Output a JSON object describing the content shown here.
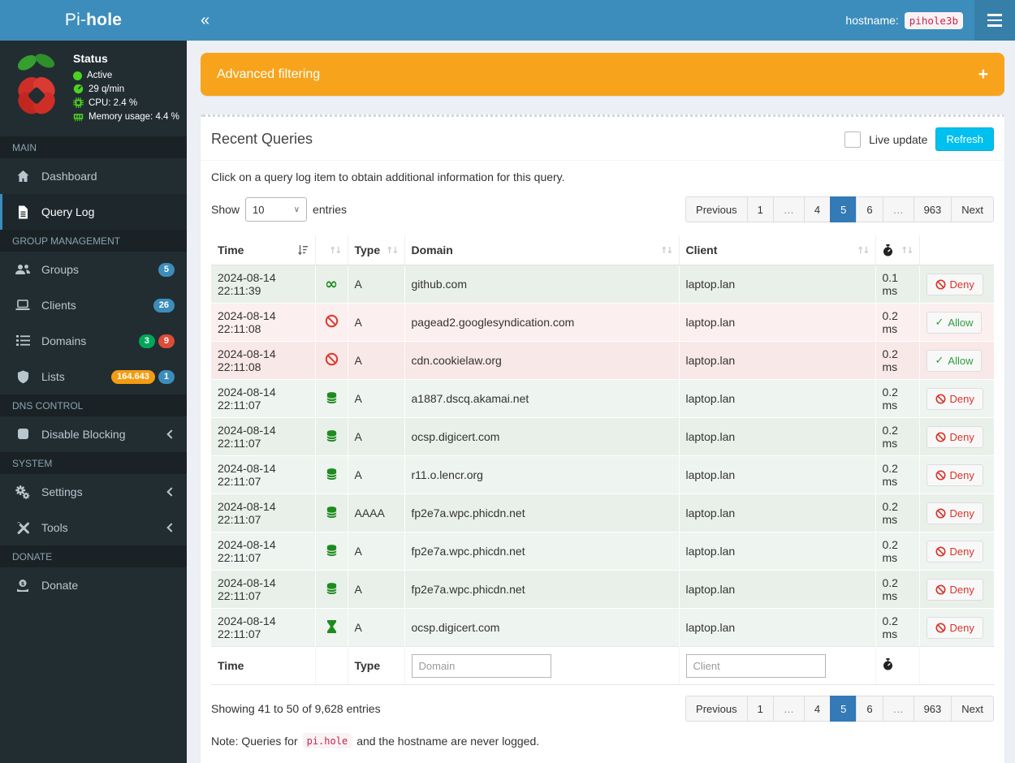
{
  "header": {
    "brand_pre": "Pi-",
    "brand_bold": "hole",
    "collapse_icon": "«",
    "hostname_label": "hostname:",
    "hostname_value": "pihole3b"
  },
  "colors": {
    "topbar_blue": "#3c8dbc",
    "sidebar_dark": "#222d32",
    "filter_orange": "#f7a41c",
    "refresh_cyan": "#00c0ef",
    "pagination_active_blue": "#337ab7",
    "allowed_row_green": "#e9f0ea",
    "blocked_row_pink": "#f9e8e8",
    "icon_green": "#1f8b1f",
    "icon_red": "#dd3b2f"
  },
  "sidebar": {
    "status": {
      "title": "Status",
      "items": [
        {
          "icon": "status-active-icon",
          "label": "Active"
        },
        {
          "icon": "gauge-icon",
          "label": "29 q/min"
        },
        {
          "icon": "cpu-icon",
          "label": "CPU: 2.4 %"
        },
        {
          "icon": "memory-icon",
          "label": "Memory usage: 4.4 %"
        }
      ]
    },
    "sections": [
      {
        "label": "MAIN",
        "items": [
          {
            "label": "Dashboard",
            "icon": "home-icon"
          },
          {
            "label": "Query Log",
            "icon": "file-icon",
            "active": true
          }
        ]
      },
      {
        "label": "GROUP MANAGEMENT",
        "items": [
          {
            "label": "Groups",
            "icon": "users-icon",
            "badges": [
              {
                "text": "5",
                "color": "blue"
              }
            ]
          },
          {
            "label": "Clients",
            "icon": "laptop-icon",
            "badges": [
              {
                "text": "26",
                "color": "blue"
              }
            ]
          },
          {
            "label": "Domains",
            "icon": "list-icon",
            "badges": [
              {
                "text": "3",
                "color": "green"
              },
              {
                "text": "9",
                "color": "red"
              }
            ]
          },
          {
            "label": "Lists",
            "icon": "shield-icon",
            "badges": [
              {
                "text": "164.643",
                "color": "orange"
              },
              {
                "text": "1",
                "color": "blue"
              }
            ]
          }
        ]
      },
      {
        "label": "DNS CONTROL",
        "items": [
          {
            "label": "Disable Blocking",
            "icon": "stop-icon",
            "chevron": true
          }
        ]
      },
      {
        "label": "SYSTEM",
        "items": [
          {
            "label": "Settings",
            "icon": "gears-icon",
            "chevron": true
          },
          {
            "label": "Tools",
            "icon": "tools-icon",
            "chevron": true
          }
        ]
      },
      {
        "label": "DONATE",
        "items": [
          {
            "label": "Donate",
            "icon": "donate-icon"
          }
        ]
      }
    ]
  },
  "filter": {
    "title": "Advanced filtering",
    "expand_icon": "+"
  },
  "recent_queries": {
    "title": "Recent Queries",
    "live_update_label": "Live update",
    "refresh_label": "Refresh",
    "hint": "Click on a query log item to obtain additional information for this query.",
    "show_label": "Show",
    "page_size": "10",
    "entries_label": "entries",
    "info": "Showing 41 to 50 of 9,628 entries"
  },
  "pagination": {
    "items": [
      "Previous",
      "1",
      "…",
      "4",
      "5",
      "6",
      "…",
      "963",
      "Next"
    ],
    "active": "5"
  },
  "table": {
    "columns": {
      "time": "Time",
      "type": "Type",
      "domain": "Domain",
      "client": "Client"
    },
    "footer": {
      "time": "Time",
      "type": "Type",
      "domain_placeholder": "Domain",
      "client_placeholder": "Client"
    },
    "rows": [
      {
        "time": "2024-08-14 22:11:39",
        "status": "cached-infinity",
        "type": "A",
        "domain": "github.com",
        "client": "laptop.lan",
        "reply": "0.1 ms",
        "action": "Deny"
      },
      {
        "time": "2024-08-14 22:11:08",
        "status": "blocked-ban",
        "type": "A",
        "domain": "pagead2.googlesyndication.com",
        "client": "laptop.lan",
        "reply": "0.2 ms",
        "action": "Allow"
      },
      {
        "time": "2024-08-14 22:11:08",
        "status": "blocked-ban",
        "type": "A",
        "domain": "cdn.cookielaw.org",
        "client": "laptop.lan",
        "reply": "0.2 ms",
        "action": "Allow"
      },
      {
        "time": "2024-08-14 22:11:07",
        "status": "database",
        "type": "A",
        "domain": "a1887.dscq.akamai.net",
        "client": "laptop.lan",
        "reply": "0.2 ms",
        "action": "Deny"
      },
      {
        "time": "2024-08-14 22:11:07",
        "status": "database",
        "type": "A",
        "domain": "ocsp.digicert.com",
        "client": "laptop.lan",
        "reply": "0.2 ms",
        "action": "Deny"
      },
      {
        "time": "2024-08-14 22:11:07",
        "status": "database",
        "type": "A",
        "domain": "r11.o.lencr.org",
        "client": "laptop.lan",
        "reply": "0.2 ms",
        "action": "Deny"
      },
      {
        "time": "2024-08-14 22:11:07",
        "status": "database",
        "type": "AAAA",
        "domain": "fp2e7a.wpc.phicdn.net",
        "client": "laptop.lan",
        "reply": "0.2 ms",
        "action": "Deny"
      },
      {
        "time": "2024-08-14 22:11:07",
        "status": "database",
        "type": "A",
        "domain": "fp2e7a.wpc.phicdn.net",
        "client": "laptop.lan",
        "reply": "0.2 ms",
        "action": "Deny"
      },
      {
        "time": "2024-08-14 22:11:07",
        "status": "database",
        "type": "A",
        "domain": "fp2e7a.wpc.phicdn.net",
        "client": "laptop.lan",
        "reply": "0.2 ms",
        "action": "Deny"
      },
      {
        "time": "2024-08-14 22:11:07",
        "status": "hourglass",
        "type": "A",
        "domain": "ocsp.digicert.com",
        "client": "laptop.lan",
        "reply": "0.2 ms",
        "action": "Deny"
      }
    ]
  },
  "note": {
    "prefix": "Note: Queries for",
    "code": "pi.hole",
    "suffix": "and the hostname are never logged."
  }
}
